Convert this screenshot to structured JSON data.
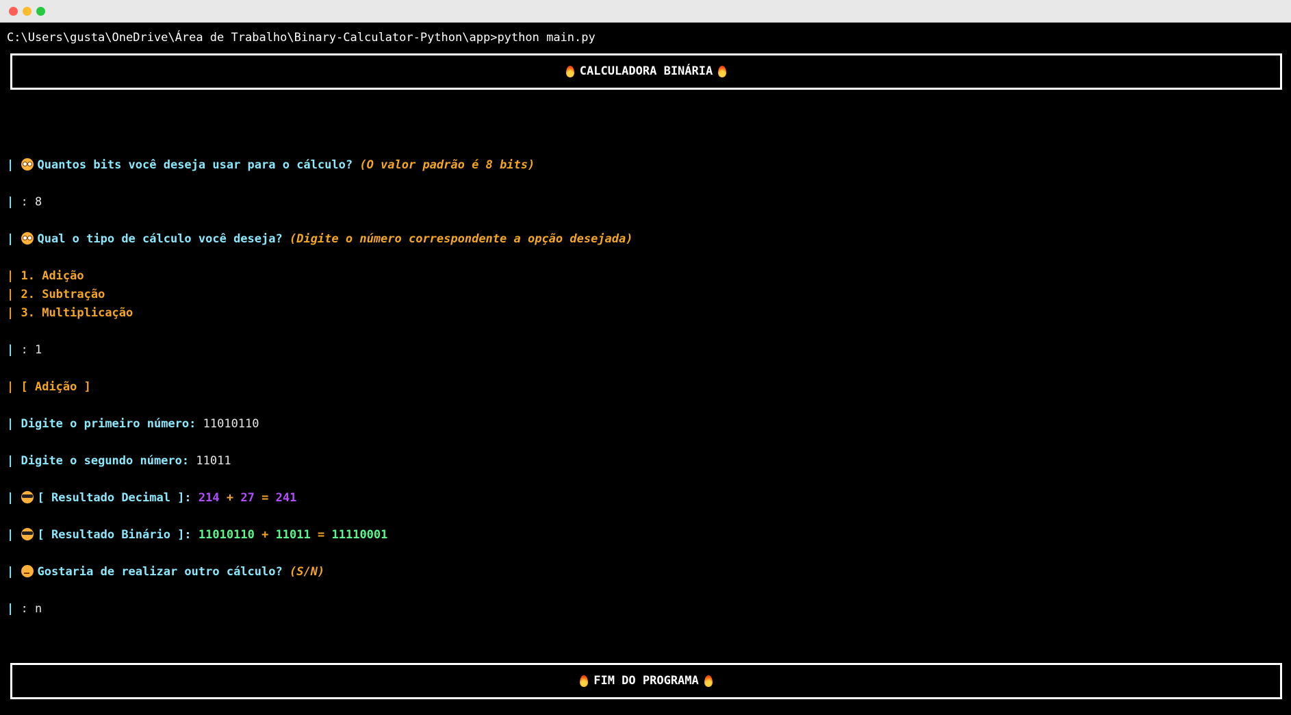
{
  "command_line": "C:\\Users\\gusta\\OneDrive\\Área de Trabalho\\Binary-Calculator-Python\\app>python main.py",
  "header_banner": "CALCULADORA BINÁRIA",
  "footer_banner": "FIM DO PROGRAMA",
  "prompt_bar": "|",
  "bits_question": {
    "text": "Quantos bits você deseja usar para o cálculo?",
    "hint": "(O valor padrão é 8 bits)",
    "answer": ": 8"
  },
  "type_question": {
    "text": "Qual o tipo de cálculo você deseja?",
    "hint": "(Digite o número correspondente a opção desejada)",
    "options": [
      "1. Adição",
      "2. Subtração",
      "3. Multiplicação"
    ],
    "answer": ": 1"
  },
  "selected_operation": "[ Adição ]",
  "first_number": {
    "label": "Digite o primeiro número:",
    "value": "11010110"
  },
  "second_number": {
    "label": "Digite o segundo número:",
    "value": "11011"
  },
  "decimal_result": {
    "label": "[ Resultado Decimal ]:",
    "a": "214",
    "op": "+",
    "b": "27",
    "eq": "=",
    "result": "241"
  },
  "binary_result": {
    "label": "[ Resultado Binário ]:",
    "a": "11010110",
    "op": "+",
    "b": "11011",
    "eq": "=",
    "result": "11110001"
  },
  "again_question": {
    "text": "Gostaria de realizar outro cálculo?",
    "hint": "(S/N)",
    "answer": ": n"
  },
  "icons": {
    "banner": "fire-icon",
    "question": "dizzy-face-icon",
    "result": "sunglasses-face-icon",
    "again": "thinking-face-icon"
  },
  "colors": {
    "background": "#000000",
    "cyan": "#8be9fd",
    "orange": "#f5a623",
    "purple": "#b04dff",
    "green": "#5af78e",
    "white": "#ffffff"
  }
}
